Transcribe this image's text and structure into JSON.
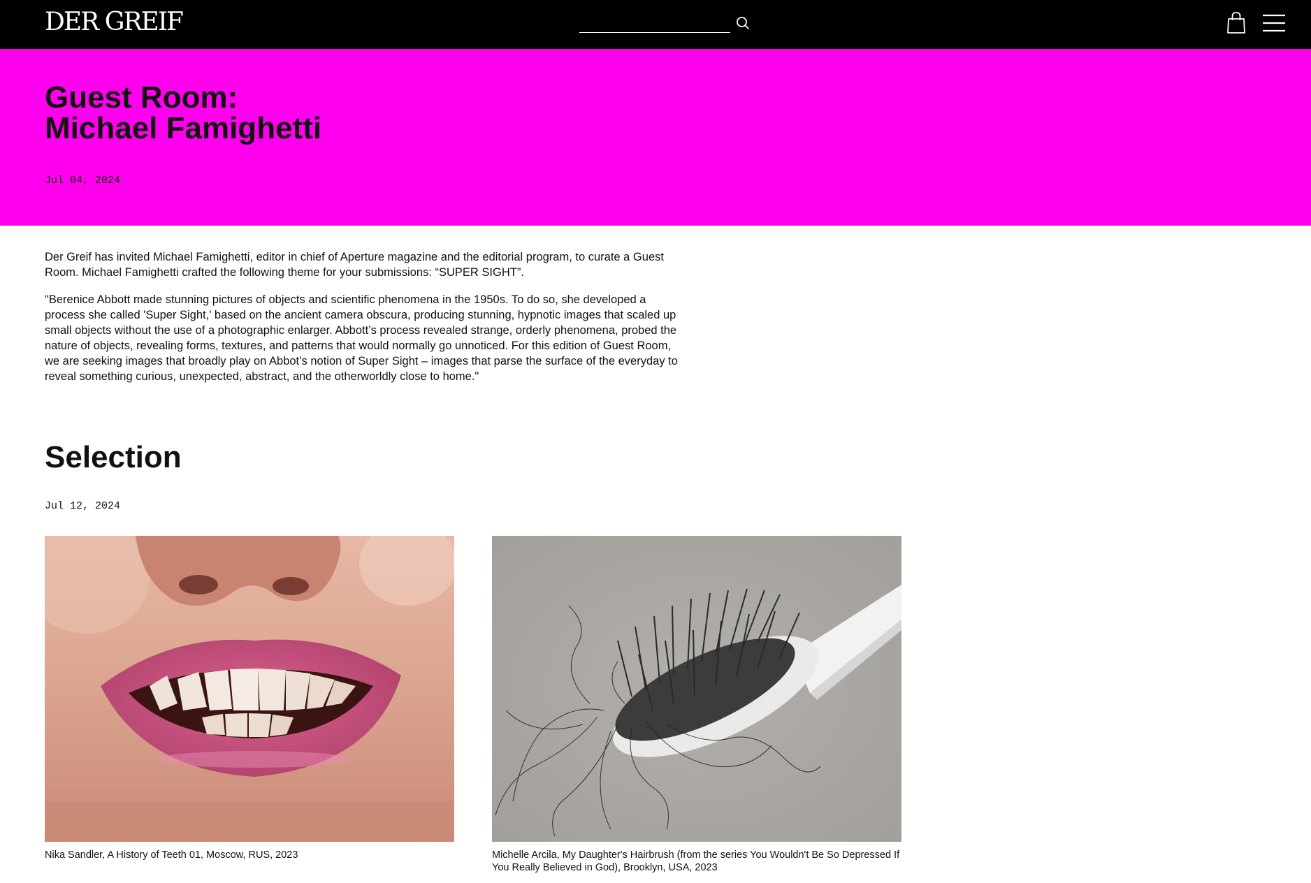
{
  "header": {
    "logo": "DER GREIF",
    "search": {
      "value": "",
      "placeholder": ""
    }
  },
  "hero": {
    "title_line1": "Guest Room:",
    "title_line2": "Michael Famighetti",
    "date": "Jul 04, 2024",
    "background_color": "#ff00ee"
  },
  "intro": {
    "paragraph1": "Der Greif has invited Michael Famighetti, editor in chief of Aperture magazine and the editorial program, to curate a Guest Room. Michael Famighetti crafted the following theme for your submissions: “SUPER SIGHT”.",
    "paragraph2": "\"Berenice Abbott made stunning pictures of objects and scientific phenomena in the 1950s. To do so, she developed a process she called 'Super Sight,' based on the ancient camera obscura, producing stunning, hypnotic images that scaled up small objects without the use of a photographic enlarger. Abbott’s process revealed strange, orderly phenomena, probed the nature of objects, revealing forms, textures, and patterns that would normally go unnoticed. For this edition of Guest Room, we are seeking images that broadly play on Abbot’s notion of Super Sight – images that parse the surface of the everyday to reveal something curious, unexpected, abstract, and the otherworldly close to home.\""
  },
  "selection": {
    "title": "Selection",
    "date": "Jul 12, 2024",
    "items": [
      {
        "caption": "Nika Sandler, A History of Teeth 01, Moscow, RUS, 2023",
        "image": "close-up-smiling-mouth-photo"
      },
      {
        "caption": "Michelle Arcila, My Daughter's Hairbrush (from the series You Wouldn't Be So Depressed If You Really Believed in God), Brooklyn, USA, 2023",
        "image": "hairbrush-with-hair-photo"
      }
    ]
  },
  "icons": {
    "search": "search-icon",
    "cart": "shopping-bag-icon",
    "menu": "hamburger-menu-icon"
  }
}
